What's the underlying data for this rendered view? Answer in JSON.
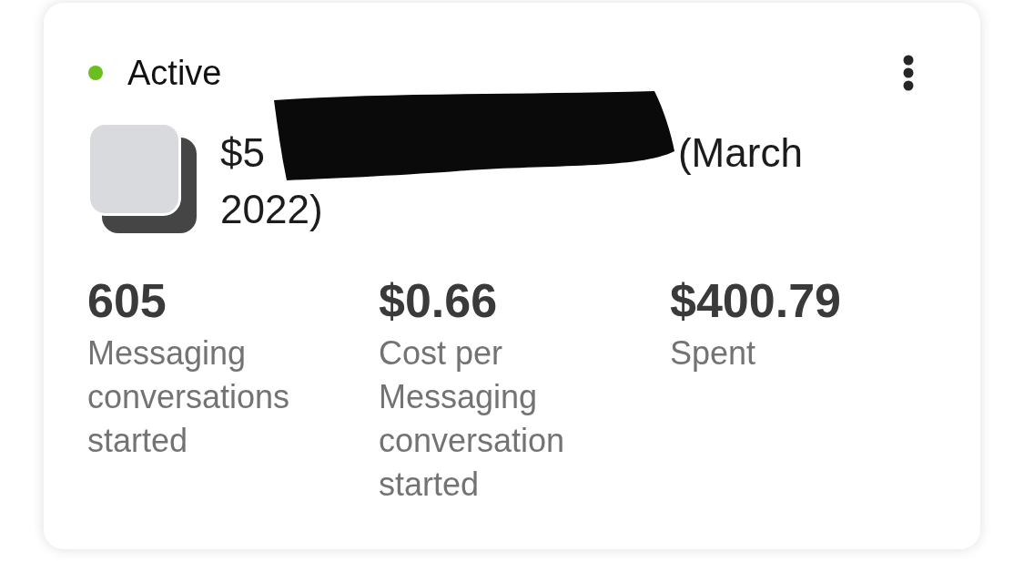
{
  "card": {
    "status": {
      "label": "Active",
      "color": "#6abf1e"
    },
    "title": {
      "redacted": true,
      "lines": [
        [
          "$5",
          "(March"
        ],
        [
          "2022)"
        ]
      ]
    },
    "metrics": [
      {
        "value": "605",
        "label": "Messaging conversations started"
      },
      {
        "value": "$0.66",
        "label": "Cost per Messaging conversation started"
      },
      {
        "value": "$400.79",
        "label": "Spent"
      }
    ]
  }
}
